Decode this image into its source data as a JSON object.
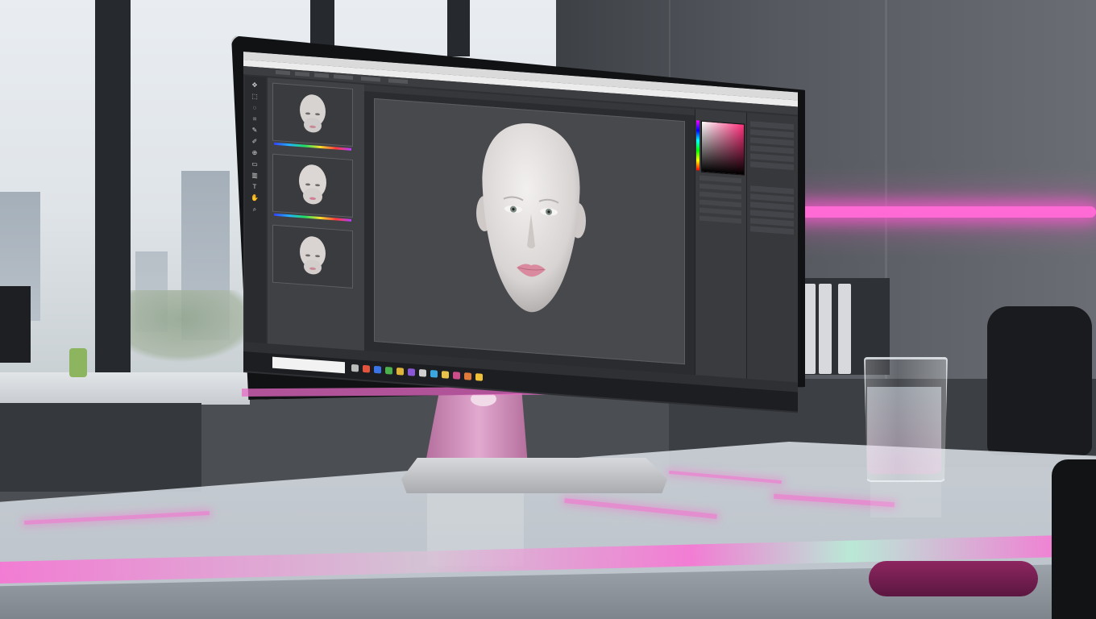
{
  "scene": {
    "description_kind": "photo",
    "accent_colors": {
      "neon": "#ff6ad5",
      "screen_bg": "#2f3033",
      "bezel": "#111214"
    }
  },
  "screen": {
    "window_title": "",
    "menu_items": [
      "",
      "",
      "",
      "",
      "",
      "",
      "",
      "",
      "",
      ""
    ],
    "taskbar_search_placeholder": "",
    "tray_text": "",
    "icons": [
      "search-icon",
      "task-view-icon",
      "browser-icon",
      "folder-icon",
      "photoshop-icon",
      "mail-icon",
      "store-icon"
    ]
  }
}
